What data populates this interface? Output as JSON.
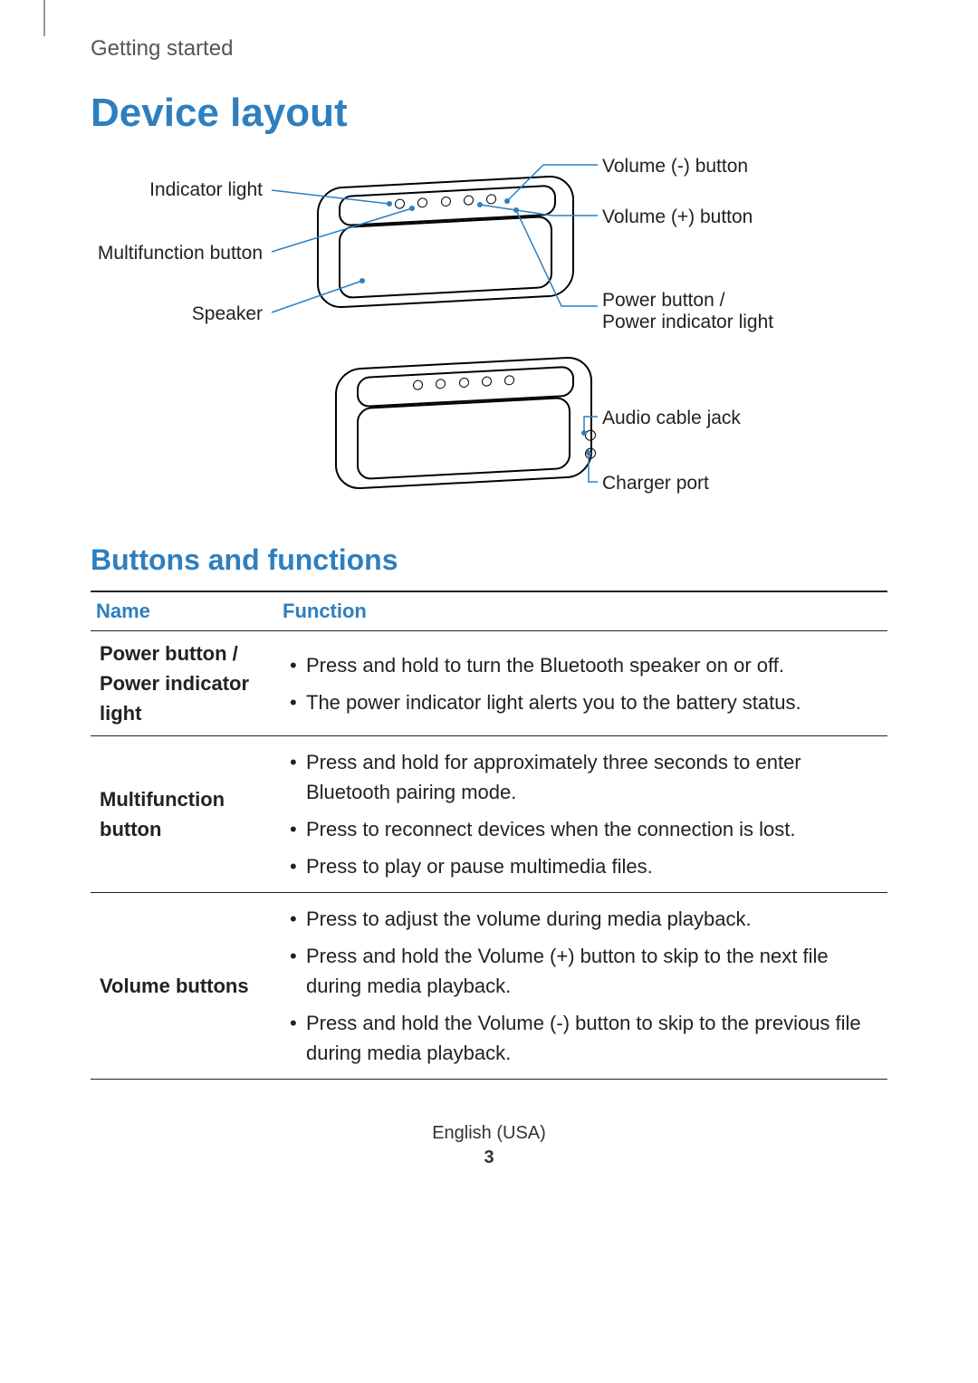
{
  "breadcrumb": "Getting started",
  "title": "Device layout",
  "diagram_labels": {
    "left": {
      "indicator_light": "Indicator light",
      "multifunction_button": "Multifunction button",
      "speaker": "Speaker"
    },
    "right_top": {
      "volume_minus": "Volume (-) button",
      "volume_plus": "Volume (+) button",
      "power_button": "Power button / Power indicator light"
    },
    "right_bottom": {
      "audio_jack": "Audio cable jack",
      "charger_port": "Charger port"
    }
  },
  "section_title": "Buttons and functions",
  "table": {
    "headers": {
      "name": "Name",
      "function": "Function"
    },
    "rows": [
      {
        "name": "Power button / Power indicator light",
        "items": [
          "Press and hold to turn the Bluetooth speaker on or off.",
          "The power indicator light alerts you to the battery status."
        ]
      },
      {
        "name": "Multifunction button",
        "items": [
          "Press and hold for approximately three seconds to enter Bluetooth pairing mode.",
          "Press to reconnect devices when the connection is lost.",
          "Press to play or pause multimedia files."
        ]
      },
      {
        "name": "Volume buttons",
        "items": [
          "Press to adjust the volume during media playback.",
          "Press and hold the Volume (+) button to skip to the next file during media playback.",
          "Press and hold the Volume (-) button to skip to the previous file during media playback."
        ]
      }
    ]
  },
  "footer": {
    "lang": "English (USA)",
    "page_number": "3"
  }
}
